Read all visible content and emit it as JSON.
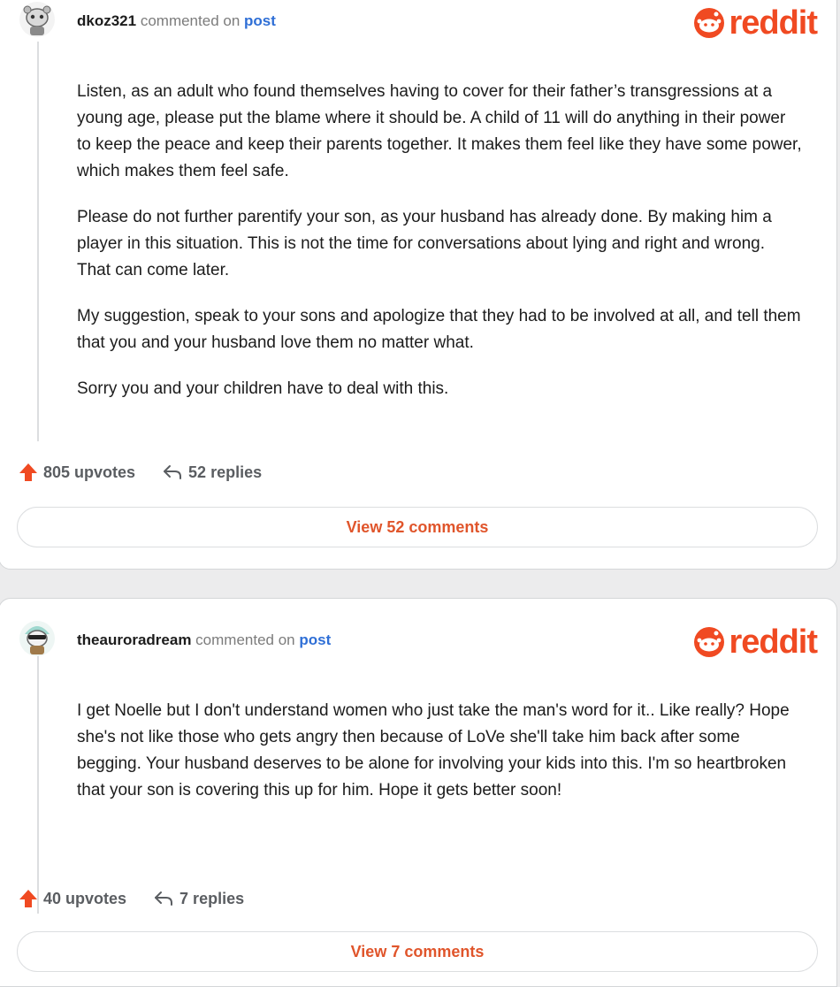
{
  "brand": {
    "logo_text": "reddit",
    "accent_color": "#f04a22",
    "link_color": "#2f6fd6"
  },
  "comments": [
    {
      "username": "dkoz321",
      "commented_text": "commented on",
      "post_link": "post",
      "avatar_icon": "snoo-avatar-icon",
      "paragraphs": [
        "Listen, as an adult who found themselves having to cover for their father’s transgressions at a young age, please put the blame where it should be. A child of 11 will do anything in their power to keep the peace and keep their parents together. It makes them feel like they have some power, which makes them feel safe.",
        "Please do not further parentify your son, as your husband has already done. By making him a player in this situation. This is not the time for conversations about lying and right and wrong. That can come later.",
        "My suggestion, speak to your sons and apologize that they had to be involved at all, and tell them that you and your husband love them no matter what.",
        "Sorry you and your children have to deal with this."
      ],
      "upvotes": "805 upvotes",
      "replies": "52 replies",
      "view_comments": "View 52 comments"
    },
    {
      "username": "theauroradream",
      "commented_text": "commented on",
      "post_link": "post",
      "avatar_icon": "snoo-avatar-icon",
      "paragraphs": [
        "I get Noelle but I don't understand women who just take the man's word for it.. Like really? Hope she's not like those who gets angry then because of LoVe she'll take him back after some begging. Your husband deserves to be alone for involving your kids into this. I'm so heartbroken that your son is covering this up for him. Hope it gets better soon!"
      ],
      "upvotes": "40 upvotes",
      "replies": "7 replies",
      "view_comments": "View 7 comments"
    }
  ]
}
